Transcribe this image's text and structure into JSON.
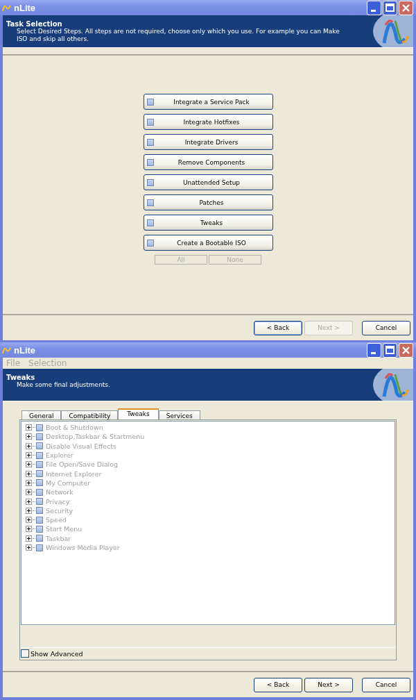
{
  "windows": [
    {
      "title": "nLite",
      "header": {
        "title": "Task Selection",
        "subtitle": "Select Desired Steps. All steps are not required, choose only which you use. For example you can Make ISO and skip all others."
      },
      "tasks": [
        {
          "label": "Integrate a Service Pack",
          "checked": false
        },
        {
          "label": "Integrate Hotfixes",
          "checked": false
        },
        {
          "label": "Integrate Drivers",
          "checked": false
        },
        {
          "label": "Remove Components",
          "checked": false
        },
        {
          "label": "Unattended Setup",
          "checked": false
        },
        {
          "label": "Patches",
          "checked": false
        },
        {
          "label": "Tweaks",
          "checked": false
        },
        {
          "label": "Create a Bootable ISO",
          "checked": false
        }
      ],
      "select_buttons": [
        {
          "label": "All",
          "disabled": true
        },
        {
          "label": "None",
          "disabled": true
        }
      ],
      "buttons": [
        {
          "label": "< Back",
          "disabled": false,
          "default": true
        },
        {
          "label": "Next >",
          "disabled": true,
          "default": false
        },
        {
          "label": "Cancel",
          "disabled": false,
          "default": false
        }
      ]
    },
    {
      "title": "nLite",
      "menu": [
        "File",
        "Selection"
      ],
      "header": {
        "title": "Tweaks",
        "subtitle": "Make some final adjustments."
      },
      "tabs": [
        {
          "label": "General",
          "selected": false
        },
        {
          "label": "Compatibility",
          "selected": false
        },
        {
          "label": "Tweaks",
          "selected": true
        },
        {
          "label": "Services",
          "selected": false
        }
      ],
      "tree": [
        {
          "label": "Boot & Shutdown",
          "disabled": true,
          "expanded": false,
          "checked": false
        },
        {
          "label": "Desktop,Taskbar & Startmenu",
          "disabled": true,
          "expanded": false,
          "checked": false
        },
        {
          "label": "Disable Visual Effects",
          "disabled": true,
          "expanded": false,
          "checked": false
        },
        {
          "label": "Explorer",
          "disabled": true,
          "expanded": false,
          "checked": false
        },
        {
          "label": "File Open/Save Dialog",
          "disabled": true,
          "expanded": false,
          "checked": false
        },
        {
          "label": "Internet Explorer",
          "disabled": true,
          "expanded": false,
          "checked": false
        },
        {
          "label": "My Computer",
          "disabled": true,
          "expanded": false,
          "checked": false
        },
        {
          "label": "Network",
          "disabled": true,
          "expanded": false,
          "checked": false
        },
        {
          "label": "Privacy",
          "disabled": true,
          "expanded": false,
          "checked": false
        },
        {
          "label": "Security",
          "disabled": true,
          "expanded": false,
          "checked": false
        },
        {
          "label": "Speed",
          "disabled": true,
          "expanded": false,
          "checked": false
        },
        {
          "label": "Start Menu",
          "disabled": true,
          "expanded": false,
          "checked": false
        },
        {
          "label": "Taskbar",
          "disabled": true,
          "expanded": false,
          "checked": false
        },
        {
          "label": "Windows Media Player",
          "disabled": true,
          "expanded": false,
          "checked": false
        }
      ],
      "show_advanced": {
        "label": "Show Advanced",
        "checked": false
      },
      "buttons": [
        {
          "label": "< Back",
          "disabled": false,
          "default": false
        },
        {
          "label": "Next >",
          "disabled": false,
          "default": false
        },
        {
          "label": "Cancel",
          "disabled": false,
          "default": false
        }
      ]
    }
  ]
}
